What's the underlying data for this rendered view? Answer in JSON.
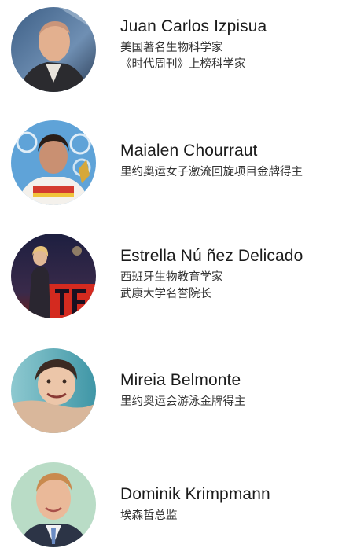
{
  "speakers": [
    {
      "name": "Juan Carlos Izpisua",
      "lines": [
        "美国著名生物科学家",
        "《时代周刊》上榜科学家"
      ]
    },
    {
      "name": "Maialen Chourraut",
      "lines": [
        "里约奥运女子激流回旋项目金牌得主"
      ]
    },
    {
      "name": "Estrella Nú ñez Delicado",
      "lines": [
        "西班牙生物教育学家",
        "武康大学名誉院长"
      ]
    },
    {
      "name": "Mireia Belmonte",
      "lines": [
        "里约奥运会游泳金牌得主"
      ]
    },
    {
      "name": "Dominik Krimpmann",
      "lines": [
        "埃森哲总监"
      ]
    }
  ],
  "colors": {
    "name_text": "#1b1b1b",
    "desc_text": "#333333",
    "background": "#ffffff"
  }
}
